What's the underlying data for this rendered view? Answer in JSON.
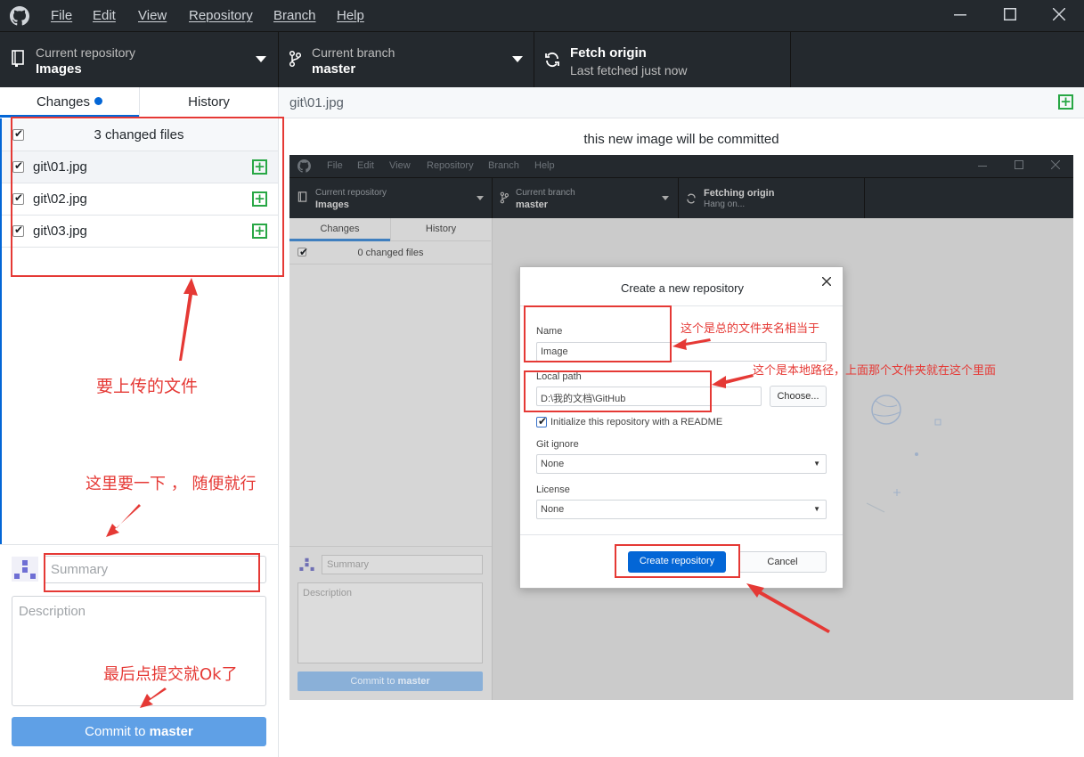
{
  "menubar": {
    "items": [
      "File",
      "Edit",
      "View",
      "Repository",
      "Branch",
      "Help"
    ]
  },
  "toolbar": {
    "repo_label": "Current repository",
    "repo_value": "Images",
    "branch_label": "Current branch",
    "branch_value": "master",
    "fetch_title": "Fetch origin",
    "fetch_subtitle": "Last fetched just now"
  },
  "sidebar": {
    "tabs": {
      "changes": "Changes",
      "history": "History"
    },
    "changed_files_header": "3 changed files",
    "files": [
      "git\\01.jpg",
      "git\\02.jpg",
      "git\\03.jpg"
    ],
    "summary_placeholder": "Summary",
    "description_placeholder": "Description",
    "commit_prefix": "Commit to ",
    "commit_branch": "master"
  },
  "main": {
    "file_path": "git\\01.jpg",
    "caption": "this new image will be committed"
  },
  "annotations": {
    "files_to_upload": "要上传的文件",
    "fill_summary": "这里要一下 ， 随便就行",
    "commit_hint": "最后点提交就Ok了",
    "folder_name_hint": "这个是总的文件夹名相当于",
    "local_path_hint": "这个是本地路径，上面那个文件夹就在这个里面"
  },
  "embedded": {
    "menubar": [
      "File",
      "Edit",
      "View",
      "Repository",
      "Branch",
      "Help"
    ],
    "repo_label": "Current repository",
    "repo_value": "Images",
    "branch_label": "Current branch",
    "branch_value": "master",
    "fetch_title": "Fetching origin",
    "fetch_subtitle": "Hang on...",
    "tabs": {
      "changes": "Changes",
      "history": "History"
    },
    "changed_files_header": "0 changed files",
    "summary_placeholder": "Summary",
    "description_placeholder": "Description",
    "commit_prefix": "Commit to ",
    "commit_branch": "master",
    "dialog": {
      "title": "Create a new repository",
      "name_label": "Name",
      "name_value": "Image",
      "path_label": "Local path",
      "path_value": "D:\\我的文档\\GitHub",
      "choose_label": "Choose...",
      "readme_label": "Initialize this repository with a README",
      "gitignore_label": "Git ignore",
      "gitignore_value": "None",
      "license_label": "License",
      "license_value": "None",
      "create_label": "Create repository",
      "cancel_label": "Cancel"
    }
  },
  "colors": {
    "chrome_dark": "#24292e",
    "accent_blue": "#0366d6",
    "add_green": "#28a745",
    "annotation_red": "#e53935",
    "commit_button": "#5fa0e6"
  },
  "icons": [
    "github-logo-icon",
    "repo-book-icon",
    "branch-icon",
    "sync-icon",
    "add-file-icon",
    "avatar-icon",
    "minimize-icon",
    "maximize-icon",
    "close-icon"
  ]
}
